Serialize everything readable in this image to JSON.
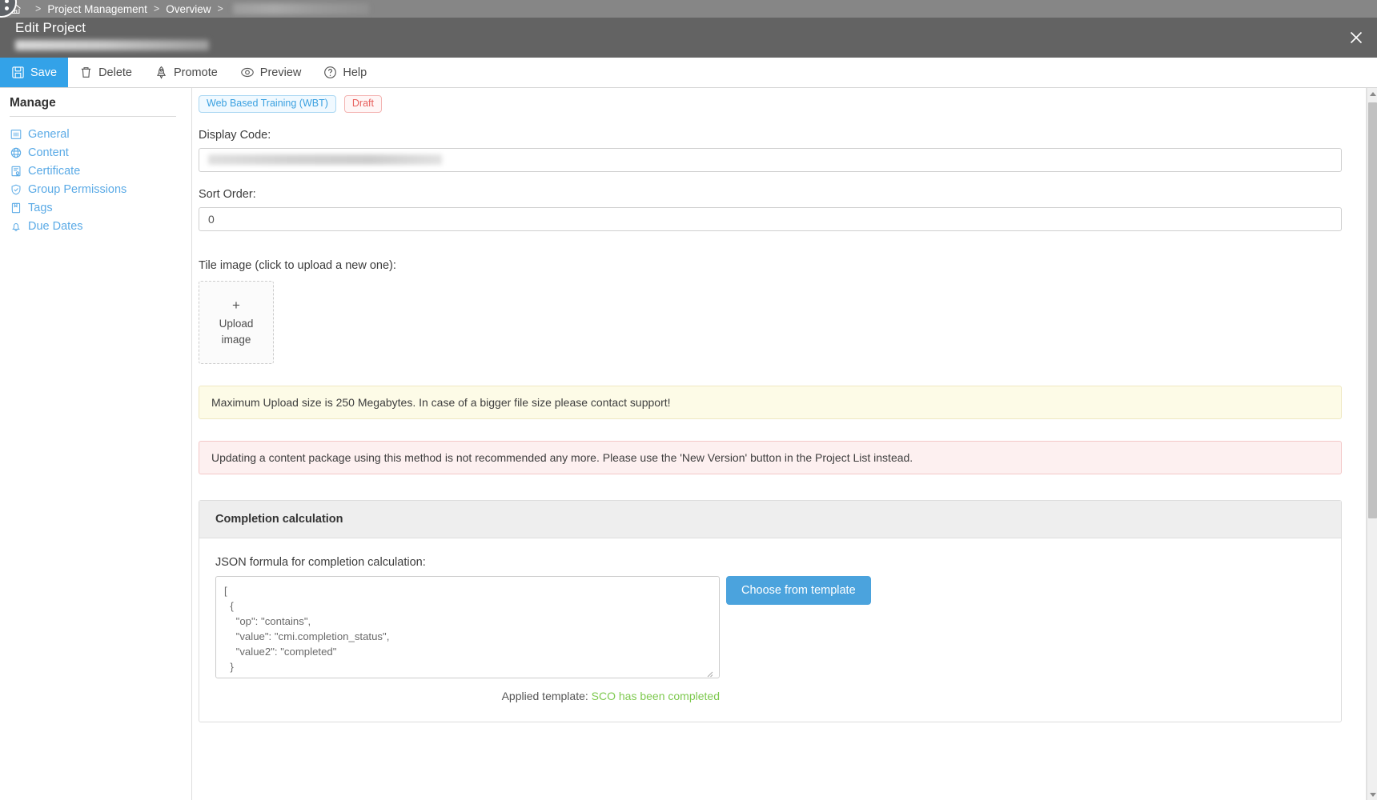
{
  "breadcrumb": {
    "home_icon": "home-icon",
    "separator": ">",
    "items": [
      "Project Management",
      "Overview"
    ],
    "redacted_tail": ""
  },
  "window": {
    "title": "Edit Project",
    "subtitle_redacted": "",
    "close_label": "✕"
  },
  "toolbar": {
    "items": [
      {
        "label": "Save",
        "icon": "save-icon",
        "active": true
      },
      {
        "label": "Delete",
        "icon": "trash-icon",
        "active": false
      },
      {
        "label": "Promote",
        "icon": "rocket-icon",
        "active": false
      },
      {
        "label": "Preview",
        "icon": "eye-icon",
        "active": false
      },
      {
        "label": "Help",
        "icon": "question-circle-icon",
        "active": false
      }
    ]
  },
  "sidebar": {
    "heading": "Manage",
    "items": [
      {
        "label": "General",
        "icon": "layout-icon"
      },
      {
        "label": "Content",
        "icon": "globe-icon"
      },
      {
        "label": "Certificate",
        "icon": "certificate-icon"
      },
      {
        "label": "Group Permissions",
        "icon": "shield-check-icon"
      },
      {
        "label": "Tags",
        "icon": "tag-icon"
      },
      {
        "label": "Due Dates",
        "icon": "bell-icon"
      }
    ]
  },
  "main": {
    "badges": {
      "type": "Web Based Training (WBT)",
      "status": "Draft"
    },
    "display_code": {
      "label": "Display Code:",
      "value": ""
    },
    "sort_order": {
      "label": "Sort Order:",
      "value": "0"
    },
    "tile_image": {
      "label": "Tile image (click to upload a new one):",
      "plus": "+",
      "line1": "Upload",
      "line2": "image"
    },
    "alerts": {
      "warning": "Maximum Upload size is 250 Megabytes. In case of a bigger file size please contact support!",
      "danger": "Updating a content package using this method is not recommended any more. Please use the 'New Version' button in the Project List instead."
    },
    "completion_panel": {
      "title": "Completion calculation",
      "formula_label": "JSON formula for completion calculation:",
      "json_value": "[\n  {\n    \"op\": \"contains\",\n    \"value\": \"cmi.completion_status\",\n    \"value2\": \"completed\"\n  }\n]",
      "choose_template_button": "Choose from template",
      "applied_prefix": "Applied template:",
      "applied_template": "SCO has been completed"
    }
  },
  "colors": {
    "accent_blue": "#33a2e8",
    "button_blue": "#4ba3dd",
    "link_blue": "#5aaae6",
    "draft_red": "#e8615e",
    "applied_green": "#7ec94f",
    "titlebar_gray": "#636363",
    "breadcrumb_gray": "#868686"
  }
}
